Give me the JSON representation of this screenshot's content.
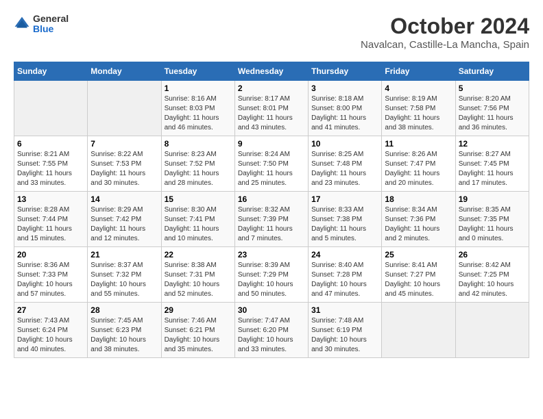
{
  "header": {
    "logo_general": "General",
    "logo_blue": "Blue",
    "month": "October 2024",
    "location": "Navalcan, Castille-La Mancha, Spain"
  },
  "weekdays": [
    "Sunday",
    "Monday",
    "Tuesday",
    "Wednesday",
    "Thursday",
    "Friday",
    "Saturday"
  ],
  "weeks": [
    [
      {
        "day": "",
        "sunrise": "",
        "sunset": "",
        "daylight": ""
      },
      {
        "day": "",
        "sunrise": "",
        "sunset": "",
        "daylight": ""
      },
      {
        "day": "1",
        "sunrise": "Sunrise: 8:16 AM",
        "sunset": "Sunset: 8:03 PM",
        "daylight": "Daylight: 11 hours and 46 minutes."
      },
      {
        "day": "2",
        "sunrise": "Sunrise: 8:17 AM",
        "sunset": "Sunset: 8:01 PM",
        "daylight": "Daylight: 11 hours and 43 minutes."
      },
      {
        "day": "3",
        "sunrise": "Sunrise: 8:18 AM",
        "sunset": "Sunset: 8:00 PM",
        "daylight": "Daylight: 11 hours and 41 minutes."
      },
      {
        "day": "4",
        "sunrise": "Sunrise: 8:19 AM",
        "sunset": "Sunset: 7:58 PM",
        "daylight": "Daylight: 11 hours and 38 minutes."
      },
      {
        "day": "5",
        "sunrise": "Sunrise: 8:20 AM",
        "sunset": "Sunset: 7:56 PM",
        "daylight": "Daylight: 11 hours and 36 minutes."
      }
    ],
    [
      {
        "day": "6",
        "sunrise": "Sunrise: 8:21 AM",
        "sunset": "Sunset: 7:55 PM",
        "daylight": "Daylight: 11 hours and 33 minutes."
      },
      {
        "day": "7",
        "sunrise": "Sunrise: 8:22 AM",
        "sunset": "Sunset: 7:53 PM",
        "daylight": "Daylight: 11 hours and 30 minutes."
      },
      {
        "day": "8",
        "sunrise": "Sunrise: 8:23 AM",
        "sunset": "Sunset: 7:52 PM",
        "daylight": "Daylight: 11 hours and 28 minutes."
      },
      {
        "day": "9",
        "sunrise": "Sunrise: 8:24 AM",
        "sunset": "Sunset: 7:50 PM",
        "daylight": "Daylight: 11 hours and 25 minutes."
      },
      {
        "day": "10",
        "sunrise": "Sunrise: 8:25 AM",
        "sunset": "Sunset: 7:48 PM",
        "daylight": "Daylight: 11 hours and 23 minutes."
      },
      {
        "day": "11",
        "sunrise": "Sunrise: 8:26 AM",
        "sunset": "Sunset: 7:47 PM",
        "daylight": "Daylight: 11 hours and 20 minutes."
      },
      {
        "day": "12",
        "sunrise": "Sunrise: 8:27 AM",
        "sunset": "Sunset: 7:45 PM",
        "daylight": "Daylight: 11 hours and 17 minutes."
      }
    ],
    [
      {
        "day": "13",
        "sunrise": "Sunrise: 8:28 AM",
        "sunset": "Sunset: 7:44 PM",
        "daylight": "Daylight: 11 hours and 15 minutes."
      },
      {
        "day": "14",
        "sunrise": "Sunrise: 8:29 AM",
        "sunset": "Sunset: 7:42 PM",
        "daylight": "Daylight: 11 hours and 12 minutes."
      },
      {
        "day": "15",
        "sunrise": "Sunrise: 8:30 AM",
        "sunset": "Sunset: 7:41 PM",
        "daylight": "Daylight: 11 hours and 10 minutes."
      },
      {
        "day": "16",
        "sunrise": "Sunrise: 8:32 AM",
        "sunset": "Sunset: 7:39 PM",
        "daylight": "Daylight: 11 hours and 7 minutes."
      },
      {
        "day": "17",
        "sunrise": "Sunrise: 8:33 AM",
        "sunset": "Sunset: 7:38 PM",
        "daylight": "Daylight: 11 hours and 5 minutes."
      },
      {
        "day": "18",
        "sunrise": "Sunrise: 8:34 AM",
        "sunset": "Sunset: 7:36 PM",
        "daylight": "Daylight: 11 hours and 2 minutes."
      },
      {
        "day": "19",
        "sunrise": "Sunrise: 8:35 AM",
        "sunset": "Sunset: 7:35 PM",
        "daylight": "Daylight: 11 hours and 0 minutes."
      }
    ],
    [
      {
        "day": "20",
        "sunrise": "Sunrise: 8:36 AM",
        "sunset": "Sunset: 7:33 PM",
        "daylight": "Daylight: 10 hours and 57 minutes."
      },
      {
        "day": "21",
        "sunrise": "Sunrise: 8:37 AM",
        "sunset": "Sunset: 7:32 PM",
        "daylight": "Daylight: 10 hours and 55 minutes."
      },
      {
        "day": "22",
        "sunrise": "Sunrise: 8:38 AM",
        "sunset": "Sunset: 7:31 PM",
        "daylight": "Daylight: 10 hours and 52 minutes."
      },
      {
        "day": "23",
        "sunrise": "Sunrise: 8:39 AM",
        "sunset": "Sunset: 7:29 PM",
        "daylight": "Daylight: 10 hours and 50 minutes."
      },
      {
        "day": "24",
        "sunrise": "Sunrise: 8:40 AM",
        "sunset": "Sunset: 7:28 PM",
        "daylight": "Daylight: 10 hours and 47 minutes."
      },
      {
        "day": "25",
        "sunrise": "Sunrise: 8:41 AM",
        "sunset": "Sunset: 7:27 PM",
        "daylight": "Daylight: 10 hours and 45 minutes."
      },
      {
        "day": "26",
        "sunrise": "Sunrise: 8:42 AM",
        "sunset": "Sunset: 7:25 PM",
        "daylight": "Daylight: 10 hours and 42 minutes."
      }
    ],
    [
      {
        "day": "27",
        "sunrise": "Sunrise: 7:43 AM",
        "sunset": "Sunset: 6:24 PM",
        "daylight": "Daylight: 10 hours and 40 minutes."
      },
      {
        "day": "28",
        "sunrise": "Sunrise: 7:45 AM",
        "sunset": "Sunset: 6:23 PM",
        "daylight": "Daylight: 10 hours and 38 minutes."
      },
      {
        "day": "29",
        "sunrise": "Sunrise: 7:46 AM",
        "sunset": "Sunset: 6:21 PM",
        "daylight": "Daylight: 10 hours and 35 minutes."
      },
      {
        "day": "30",
        "sunrise": "Sunrise: 7:47 AM",
        "sunset": "Sunset: 6:20 PM",
        "daylight": "Daylight: 10 hours and 33 minutes."
      },
      {
        "day": "31",
        "sunrise": "Sunrise: 7:48 AM",
        "sunset": "Sunset: 6:19 PM",
        "daylight": "Daylight: 10 hours and 30 minutes."
      },
      {
        "day": "",
        "sunrise": "",
        "sunset": "",
        "daylight": ""
      },
      {
        "day": "",
        "sunrise": "",
        "sunset": "",
        "daylight": ""
      }
    ]
  ]
}
